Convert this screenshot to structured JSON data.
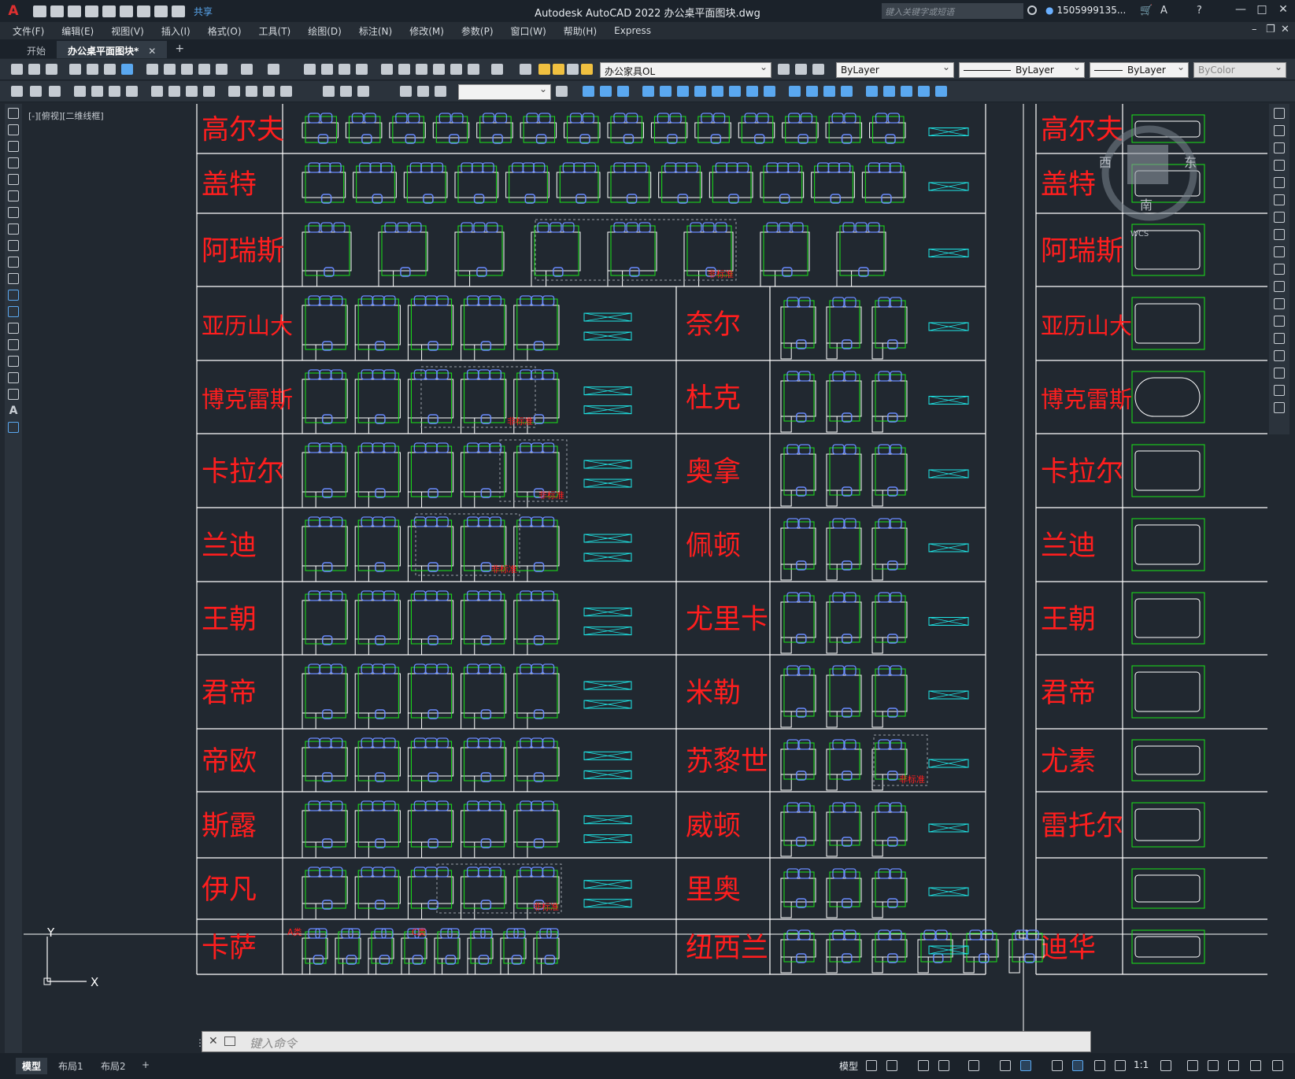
{
  "app": {
    "logo": "A",
    "share_label": "共享",
    "title": "Autodesk AutoCAD 2022    办公桌平面图块.dwg",
    "search_placeholder": "键入关键字或短语",
    "user": "1505999135...",
    "window_controls": [
      "—",
      "□",
      "✕"
    ]
  },
  "menu": [
    "文件(F)",
    "编辑(E)",
    "视图(V)",
    "插入(I)",
    "格式(O)",
    "工具(T)",
    "绘图(D)",
    "标注(N)",
    "修改(M)",
    "参数(P)",
    "窗口(W)",
    "帮助(H)",
    "Express"
  ],
  "tabs": {
    "items": [
      {
        "label": "开始",
        "active": false
      },
      {
        "label": "办公桌平面图块*",
        "active": true
      }
    ],
    "close": "✕",
    "add": "+"
  },
  "toolbar": {
    "layer": "办公家具OL",
    "color": "ByLayer",
    "linetype": "ByLayer",
    "lineweight": "ByLayer",
    "plotstyle": "ByColor"
  },
  "viewport_label": "[-][俯视][二维线框]",
  "viewcube": {
    "west": "西",
    "east": "东",
    "south": "南",
    "wcs": "WCS"
  },
  "ucs": {
    "y": "Y",
    "x": "X"
  },
  "drawing": {
    "left_names": [
      "高尔夫",
      "盖特",
      "阿瑞斯",
      "亚历山大",
      "博克雷斯",
      "卡拉尔",
      "兰迪",
      "王朝",
      "君帝",
      "帝欧",
      "斯露",
      "伊凡",
      "卡萨"
    ],
    "mid_names": [
      "奈尔",
      "杜克",
      "奥拿",
      "佩顿",
      "尤里卡",
      "米勒",
      "苏黎世",
      "威顿",
      "里奥",
      "纽西兰"
    ],
    "right_names": [
      "高尔夫",
      "盖特",
      "阿瑞斯",
      "亚历山大",
      "博克雷斯",
      "卡拉尔",
      "兰迪",
      "王朝",
      "君帝",
      "尤素",
      "雷托尔",
      "",
      "迪华"
    ],
    "nonstandard_label": "非标准",
    "a_label": "A类",
    "c_label": "C类",
    "colors": {
      "name": "#ff1e1e",
      "frame": "#ffffff",
      "green": "#19e619",
      "blue": "#6a8cff",
      "cyan": "#1ee6e6",
      "bg": "#212830"
    }
  },
  "command": {
    "placeholder": "键入命令",
    "close": "✕"
  },
  "status": {
    "layout_tabs": [
      "模型",
      "布局1",
      "布局2"
    ],
    "add_tab": "+",
    "model": "模型",
    "scale": "1:1"
  }
}
